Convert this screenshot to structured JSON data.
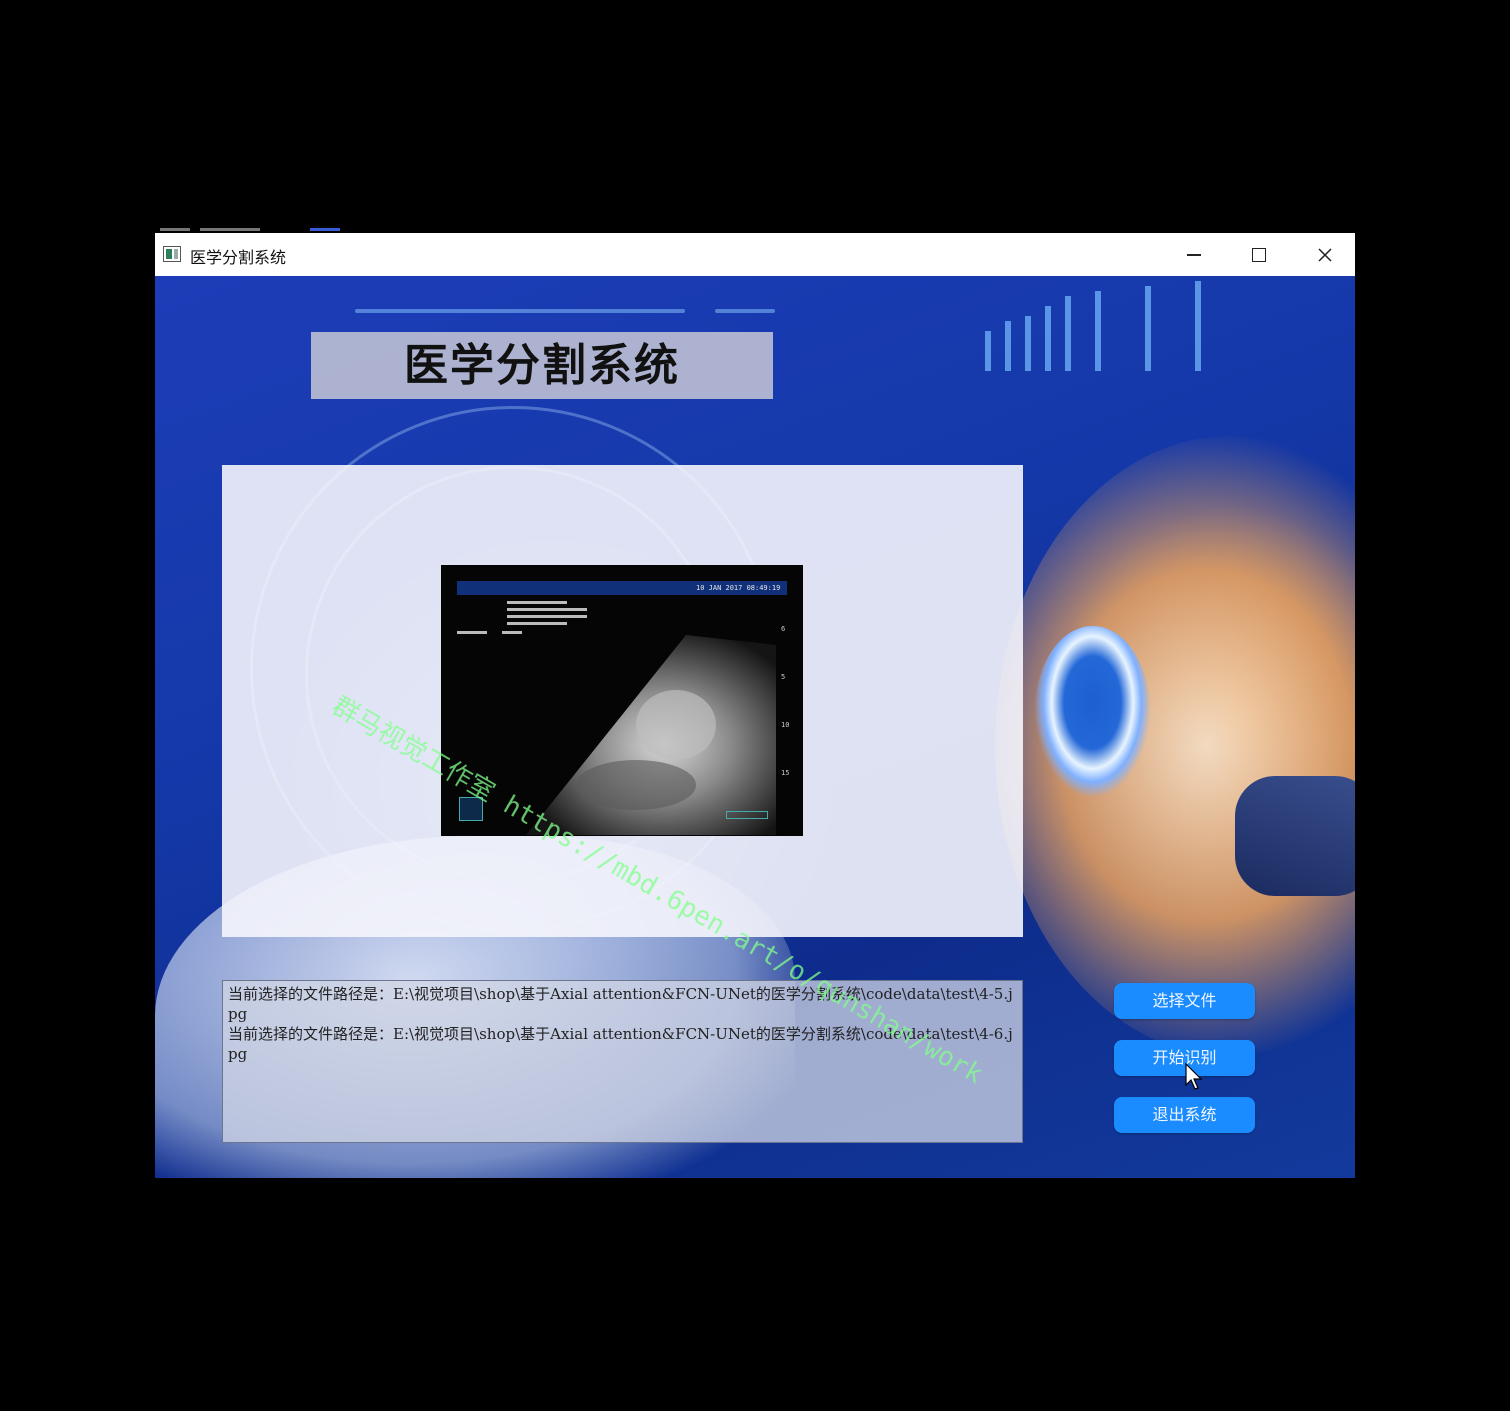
{
  "window": {
    "title": "医学分割系统",
    "controls": {
      "minimize": "minimize-icon",
      "maximize": "maximize-icon",
      "close": "close-icon"
    }
  },
  "header": {
    "title": "医学分割系统"
  },
  "image_panel": {
    "ultrasound": {
      "timestamp": "10 JAN 2017 08:49:19"
    }
  },
  "watermark": "群马视觉工作室 https://mbd.6pen.art/o/qunshan/work",
  "log": {
    "lines": [
      "当前选择的文件路径是：E:\\视觉项目\\shop\\基于Axial attention&FCN-UNet的医学分割系统\\code\\data\\test\\4-5.jpg",
      "当前选择的文件路径是：E:\\视觉项目\\shop\\基于Axial attention&FCN-UNet的医学分割系统\\code\\data\\test\\4-6.jpg"
    ]
  },
  "buttons": {
    "select_file": "选择文件",
    "start_recognition": "开始识别",
    "exit_system": "退出系统"
  },
  "colors": {
    "button_bg": "#1a8cff",
    "background_blue": "#1438a8",
    "watermark": "#82ff8c"
  }
}
